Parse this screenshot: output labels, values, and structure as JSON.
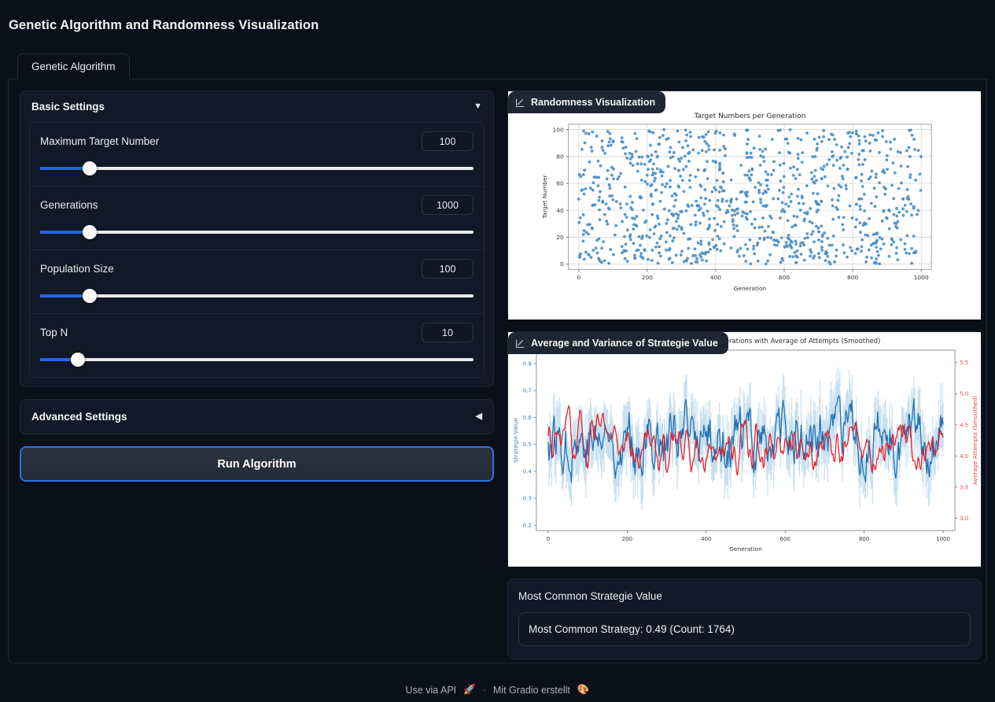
{
  "app": {
    "title": "Genetic Algorithm and Randomness Visualization"
  },
  "tabs": [
    {
      "label": "Genetic Algorithm",
      "active": true
    }
  ],
  "basic_settings": {
    "header": "Basic Settings",
    "arrow": "▼",
    "sliders": [
      {
        "label": "Maximum Target Number",
        "value": "100",
        "fill_pct": 11.5
      },
      {
        "label": "Generations",
        "value": "1000",
        "fill_pct": 11.5
      },
      {
        "label": "Population Size",
        "value": "100",
        "fill_pct": 11.5
      },
      {
        "label": "Top N",
        "value": "10",
        "fill_pct": 8.8
      }
    ]
  },
  "advanced_settings": {
    "header": "Advanced Settings",
    "arrow": "◀"
  },
  "run_button": {
    "label": "Run Algorithm"
  },
  "plots": [
    {
      "badge": "Randomness Visualization",
      "badge_icon": "chart-scatter-icon"
    },
    {
      "badge": "Average and Variance of Strategie Value",
      "badge_icon": "chart-line-icon"
    }
  ],
  "result": {
    "title": "Most Common Strategie Value",
    "value": "Most Common Strategy: 0.49 (Count: 1764)"
  },
  "footer": {
    "api_label": "Use via API",
    "api_icon": "🚀",
    "separator": "·",
    "built_with": "Mit Gradio erstellt",
    "gradio_icon": "🎨"
  },
  "colors": {
    "background": "#0b0f19",
    "panel": "#111827",
    "border": "#1f2937",
    "accent_blue": "#2563eb",
    "scatter_blue": "#4c8ec4",
    "line_blue": "#1f6fb4",
    "band_blue": "#bcd9ec",
    "line_red": "#e81c24",
    "axis_red": "#e8434b",
    "plot_bg": "#ffffff"
  },
  "chart_data": [
    {
      "type": "scatter",
      "title": "Target Numbers per Generation",
      "xlabel": "Generation",
      "ylabel": "Target Number",
      "xlim": [
        -30,
        1030
      ],
      "ylim": [
        -4,
        104
      ],
      "xticks": [
        0,
        200,
        400,
        600,
        800,
        1000
      ],
      "yticks": [
        0,
        20,
        40,
        60,
        80,
        100
      ],
      "grid": true,
      "legend": "none",
      "marker_color": "#4c8ec4",
      "n_points": 1000,
      "description": "Uniformly random target numbers between 0 and 100 for each of 1000 generations",
      "points_note": "x = generation index 0..1000, y ~ Uniform(0,100)"
    },
    {
      "type": "line",
      "title": "Average Strategie Value Over Generations with Average of Attempts (Smoothed)",
      "xlabel": "Generation",
      "ylabel": "Strategie Value",
      "ylabel_right": "Average Attempts (Smoothed)",
      "xlim": [
        -30,
        1030
      ],
      "ylim": [
        0.18,
        0.85
      ],
      "ylim_right": [
        2.8,
        5.7
      ],
      "xticks": [
        0,
        200,
        400,
        600,
        800,
        1000
      ],
      "yticks": [
        0.2,
        0.3,
        0.4,
        0.5,
        0.6,
        0.7,
        0.8
      ],
      "yticks_right": [
        3.0,
        3.5,
        4.0,
        4.5,
        5.0,
        5.5
      ],
      "grid": false,
      "legend": "none",
      "series": [
        {
          "name": "Average Strategie Value",
          "axis": "left",
          "color": "#1f6fb4",
          "mean": 0.52,
          "noise": 0.075,
          "description": "Noisy average strategy value per generation, oscillating around 0.52"
        },
        {
          "name": "Variance band of Strategie Value",
          "axis": "left",
          "color": "#bcd9ec",
          "mean": 0.52,
          "noise": 0.14,
          "description": "Light blue +/- variance envelope around the average strategy value"
        },
        {
          "name": "Average Attempts (Smoothed)",
          "axis": "right",
          "color": "#e81c24",
          "mean": 4.2,
          "noise": 0.33,
          "description": "Smoothed average number of attempts per generation, oscillating around 4.2"
        }
      ]
    }
  ]
}
